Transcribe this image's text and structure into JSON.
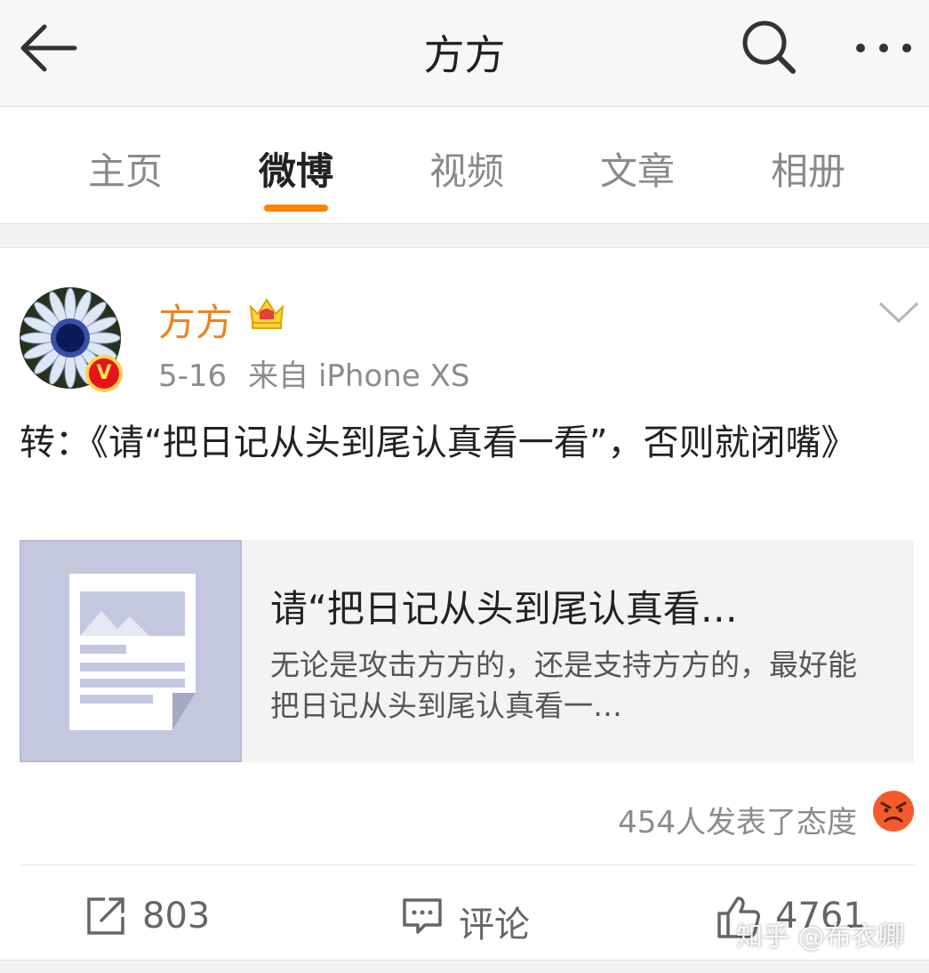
{
  "header": {
    "title": "方方",
    "back_icon": "arrow-left-icon",
    "search_icon": "search-icon",
    "more_icon": "more-dots-icon"
  },
  "tabs": [
    {
      "label": "主页",
      "active": false
    },
    {
      "label": "微博",
      "active": true
    },
    {
      "label": "视频",
      "active": false
    },
    {
      "label": "文章",
      "active": false
    },
    {
      "label": "相册",
      "active": false
    }
  ],
  "post": {
    "author": "方方",
    "badge_letter": "V",
    "date": "5-16",
    "source": "来自 iPhone XS",
    "text": "转：《请“把日记从头到尾认真看一看”，否则就闭嘴》",
    "link_card": {
      "title": "请“把日记从头到尾认真看…",
      "description": "无论是攻击方方的，还是支持方方的，最好能把日记从头到尾认真看一…"
    },
    "reactions_text": "454人发表了态度",
    "actions": {
      "repost_count": "803",
      "comment_label": "评论",
      "like_count": "4761"
    }
  },
  "watermark": "知乎 @布衣卿",
  "colors": {
    "accent": "#ff8200",
    "author_name": "#f0811c",
    "verified_badge": "#e4151b"
  }
}
